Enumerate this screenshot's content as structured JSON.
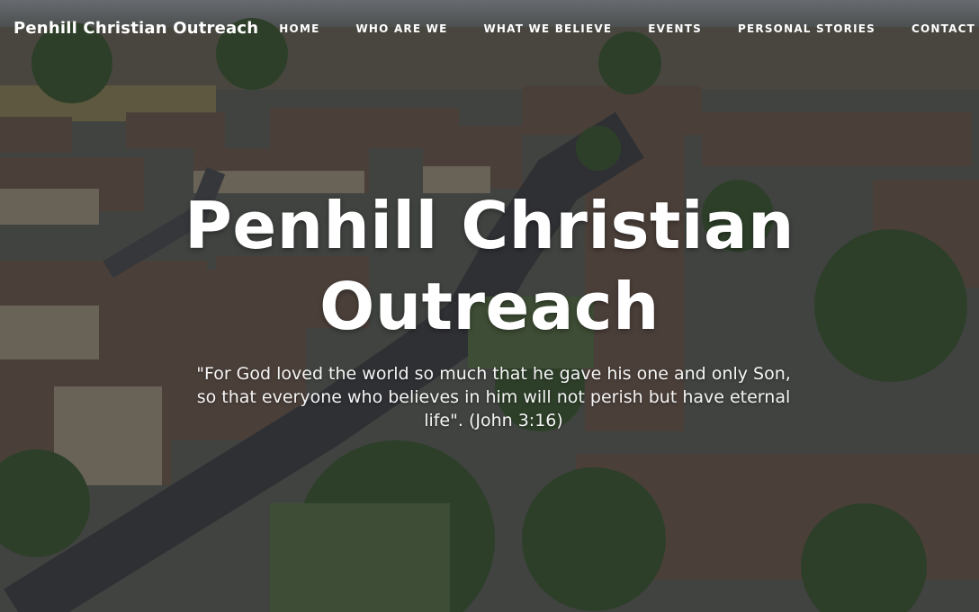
{
  "site": {
    "brand": "Penhill Christian Outreach"
  },
  "nav": {
    "items": [
      {
        "label": "HOME"
      },
      {
        "label": "WHO ARE WE"
      },
      {
        "label": "WHAT WE BELIEVE"
      },
      {
        "label": "EVENTS"
      },
      {
        "label": "PERSONAL STORIES"
      },
      {
        "label": "CONTACT"
      }
    ]
  },
  "hero": {
    "title_line1": "Penhill Christian",
    "title_line2": "Outreach",
    "quote_line1": "\"For God loved the world so much that he gave his one and only Son,",
    "quote_line2": "so that everyone who believes in him will not perish but have eternal",
    "quote_line3": "life\". (John 3:16)"
  },
  "colors": {
    "text": "#ffffff",
    "overlay": "#14161a"
  }
}
